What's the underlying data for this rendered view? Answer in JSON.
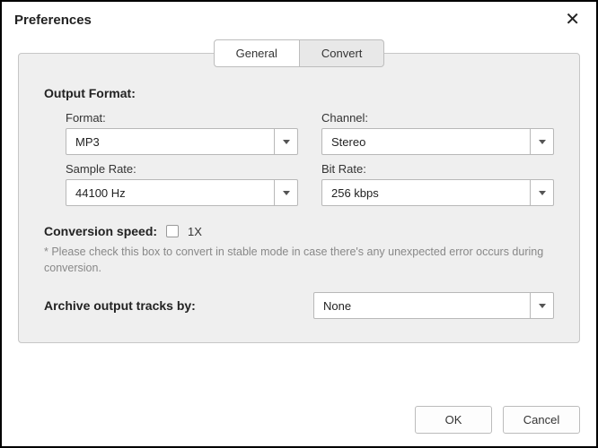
{
  "title": "Preferences",
  "tabs": {
    "general": "General",
    "convert": "Convert"
  },
  "sections": {
    "output_format": "Output Format:",
    "conversion_speed": "Conversion speed:",
    "archive": "Archive output tracks by:"
  },
  "fields": {
    "format": {
      "label": "Format:",
      "value": "MP3"
    },
    "channel": {
      "label": "Channel:",
      "value": "Stereo"
    },
    "sample_rate": {
      "label": "Sample Rate:",
      "value": "44100 Hz"
    },
    "bit_rate": {
      "label": "Bit Rate:",
      "value": "256 kbps"
    },
    "speed_value": "1X",
    "archive_value": "None"
  },
  "hint": "* Please check this box to convert in stable mode in case there's any unexpected error occurs during conversion.",
  "buttons": {
    "ok": "OK",
    "cancel": "Cancel"
  }
}
